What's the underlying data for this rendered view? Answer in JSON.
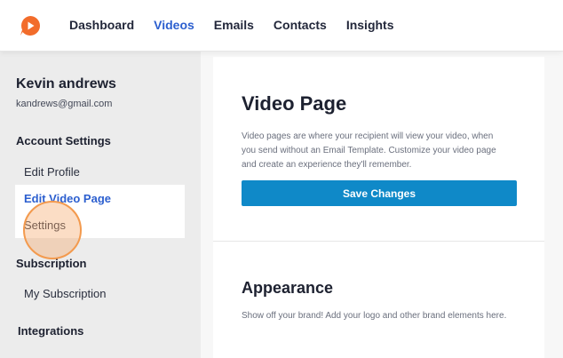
{
  "nav": {
    "items": [
      {
        "label": "Dashboard",
        "active": false
      },
      {
        "label": "Videos",
        "active": true
      },
      {
        "label": "Emails",
        "active": false
      },
      {
        "label": "Contacts",
        "active": false
      },
      {
        "label": "Insights",
        "active": false
      }
    ]
  },
  "sidebar": {
    "user": {
      "name": "Kevin andrews",
      "email": "kandrews@gmail.com"
    },
    "sections": {
      "account": {
        "title": "Account Settings",
        "links": [
          "Edit Profile",
          "Edit Video Page",
          "Settings"
        ]
      },
      "subscription": {
        "title": "Subscription",
        "links": [
          "My Subscription"
        ]
      },
      "integrations": {
        "title": "Integrations"
      }
    }
  },
  "main": {
    "title": "Video Page",
    "description": "Video pages are where your recipient will view your video, when you send without an Email Template. Customize your video page and create an experience they'll remember.",
    "save_label": "Save Changes",
    "appearance": {
      "title": "Appearance",
      "description": "Show off your brand! Add your logo and other brand elements here."
    }
  },
  "colors": {
    "accent": "#0f89c8",
    "active_link": "#2c5fcf",
    "logo": "#f26c2b",
    "click_indicator": "#f39a4e"
  },
  "icons": {
    "logo": "play-bubble-icon"
  }
}
